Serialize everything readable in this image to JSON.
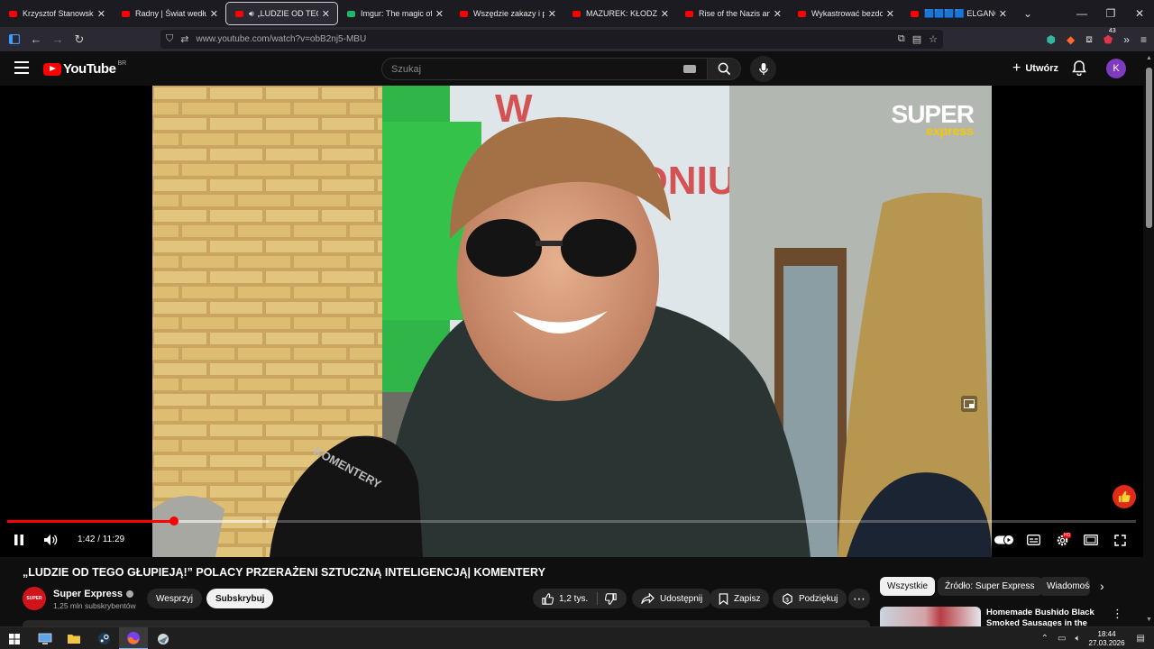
{
  "browser": {
    "tabs": [
      {
        "title": "Krzysztof Stanowski. W ja",
        "icon": "youtube-favicon",
        "active": false
      },
      {
        "title": "Radny | Świat według Kie",
        "icon": "youtube-favicon",
        "active": false
      },
      {
        "title": "„LUDZIE OD TEGO G",
        "icon": "youtube-favicon",
        "active": true,
        "audio": true
      },
      {
        "title": "Imgur: The magic of the",
        "icon": "imgur-favicon",
        "active": false
      },
      {
        "title": "Wszędzie zakazy i preter",
        "icon": "youtube-favicon",
        "active": false
      },
      {
        "title": "MAZUREK: KŁODZKO, PE",
        "icon": "youtube-favicon",
        "active": false
      },
      {
        "title": "Rise of the Nazis and Ad",
        "icon": "youtube-favicon",
        "active": false
      },
      {
        "title": "Wykastrować bezdomno",
        "icon": "youtube-favicon",
        "active": false
      },
      {
        "title": "🟦🟦🟦🟦 ELGANO",
        "icon": "youtube-favicon",
        "active": false
      }
    ],
    "url": "www.youtube.com/watch?v=obB2nj5-MBU",
    "extension_badge": "43"
  },
  "youtube": {
    "logo_text": "YouTube",
    "country_code": "BR",
    "search_placeholder": "Szukaj",
    "create_label": "Utwórz",
    "avatar_letter": "K"
  },
  "player": {
    "watermark_main": "SUPER",
    "watermark_sub": "express",
    "current_time": "1:42",
    "duration": "11:29",
    "time_display": "1:42 / 11:29",
    "played_fraction": 0.148,
    "buffered_fraction": 0.232,
    "hd_badge": "HD",
    "accent_color": "#ff0000"
  },
  "video": {
    "title": "„LUDZIE OD TEGO GŁUPIEJĄ!” POLACY PRZERAŻENI SZTUCZNĄ INTELIGENCJĄ| KOMENTERY",
    "channel_name": "Super Express",
    "channel_avatar_text": "SUPER",
    "subscribers": "1,25 mln subskrybentów",
    "support_label": "Wesprzyj",
    "subscribe_label": "Subskrybuj",
    "likes": "1,2 tys.",
    "share_label": "Udostępnij",
    "save_label": "Zapisz",
    "thanks_label": "Podziękuj"
  },
  "recommendations": {
    "chips": [
      "Wszystkie",
      "Źródło: Super Express",
      "Wiadomości"
    ],
    "first_title": "Homemade Bushido Black Smoked Sausages in the"
  },
  "taskbar": {
    "time": "18:44",
    "date": "27.03.2026"
  }
}
